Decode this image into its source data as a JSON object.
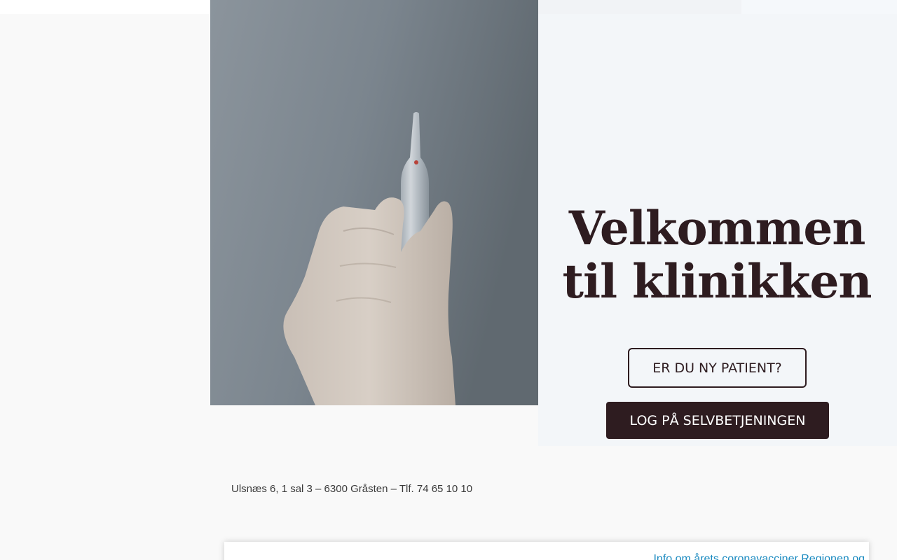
{
  "hero": {
    "title": "Velkommen til klinikken",
    "image": "hand-holding-glass-ampoule"
  },
  "buttons": {
    "new_patient": "ER DU NY PATIENT?",
    "login": "LOG PÅ SELVBETJENINGEN"
  },
  "footer": {
    "address": "Ulsnæs 6, 1 sal 3 – 6300 Gråsten – Tlf. 74 65 10 10"
  },
  "notice": {
    "link_text": "Info om årets coronavacciner Regionen og"
  },
  "colors": {
    "primary": "#2e1c20",
    "page_bg": "#f9f9f9",
    "panel_bg": "#f3f6f9",
    "link": "#1a8ac0"
  }
}
